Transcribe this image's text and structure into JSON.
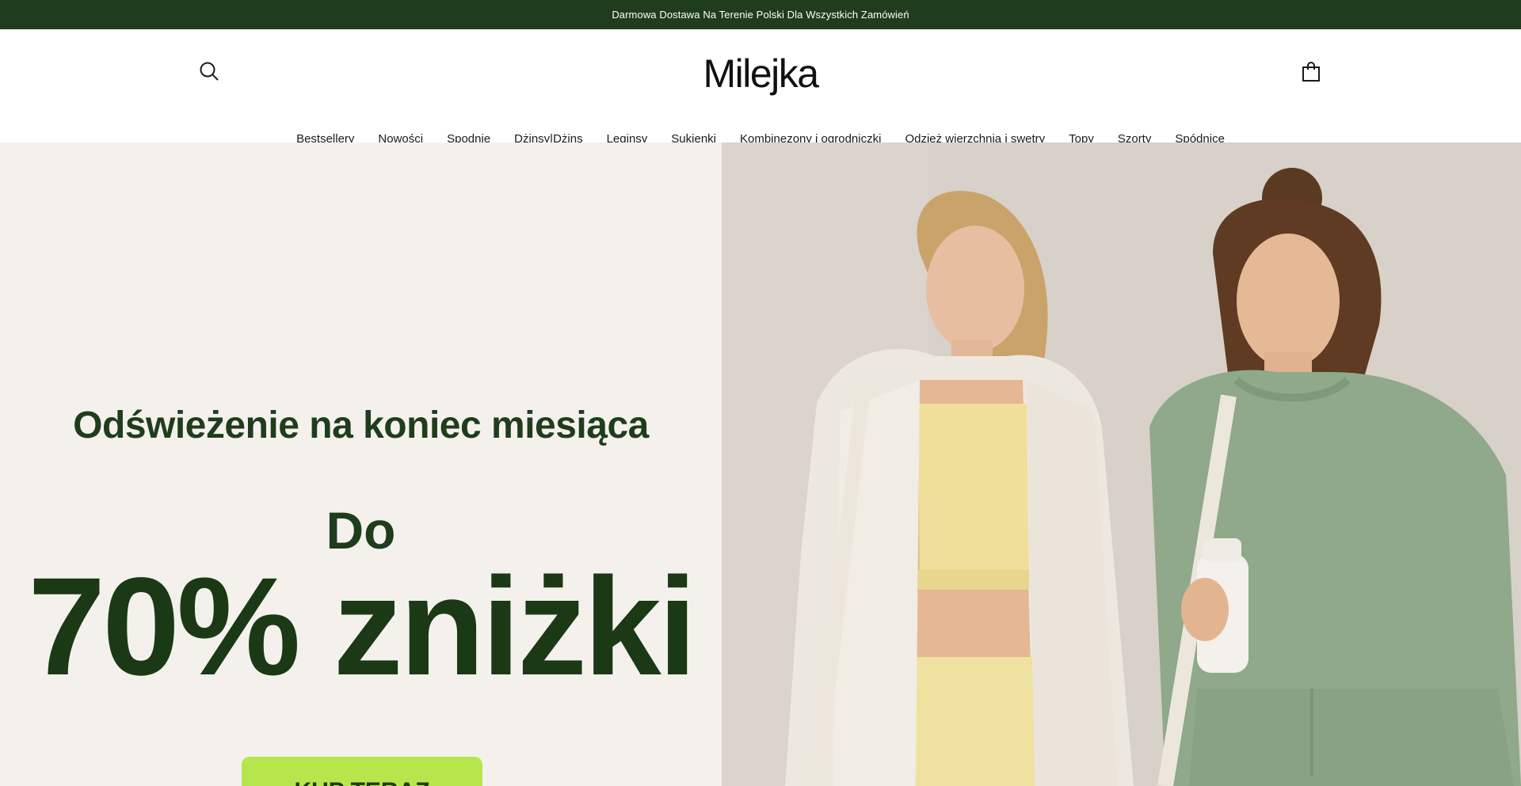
{
  "announcement": {
    "text": "Darmowa Dostawa Na Terenie Polski Dla Wszystkich Zamówień"
  },
  "header": {
    "logo": "Milejka",
    "search_icon": "search-icon",
    "cart_icon": "shopping-bag-icon"
  },
  "nav": {
    "items": [
      {
        "label": "Bestsellery"
      },
      {
        "label": "Nowości"
      },
      {
        "label": "Spodnie"
      },
      {
        "label": "Dżinsy|Dżins"
      },
      {
        "label": "Leginsy"
      },
      {
        "label": "Sukienki"
      },
      {
        "label": "Kombinezony i ogrodniczki"
      },
      {
        "label": "Odzież wierzchnia i swetry"
      },
      {
        "label": "Topy"
      },
      {
        "label": "Szorty"
      },
      {
        "label": "Spódnice"
      }
    ]
  },
  "hero": {
    "subtitle": "Odświeżenie na koniec miesiąca",
    "do_text": "Do",
    "discount": "70% zniżki",
    "cta_label": "KUP TERAZ"
  },
  "colors": {
    "announcement_bg": "#1f3d1c",
    "brand_green": "#1f3d1c",
    "cta_green": "#b6e64c",
    "hero_left_bg": "#f4f1ed"
  }
}
